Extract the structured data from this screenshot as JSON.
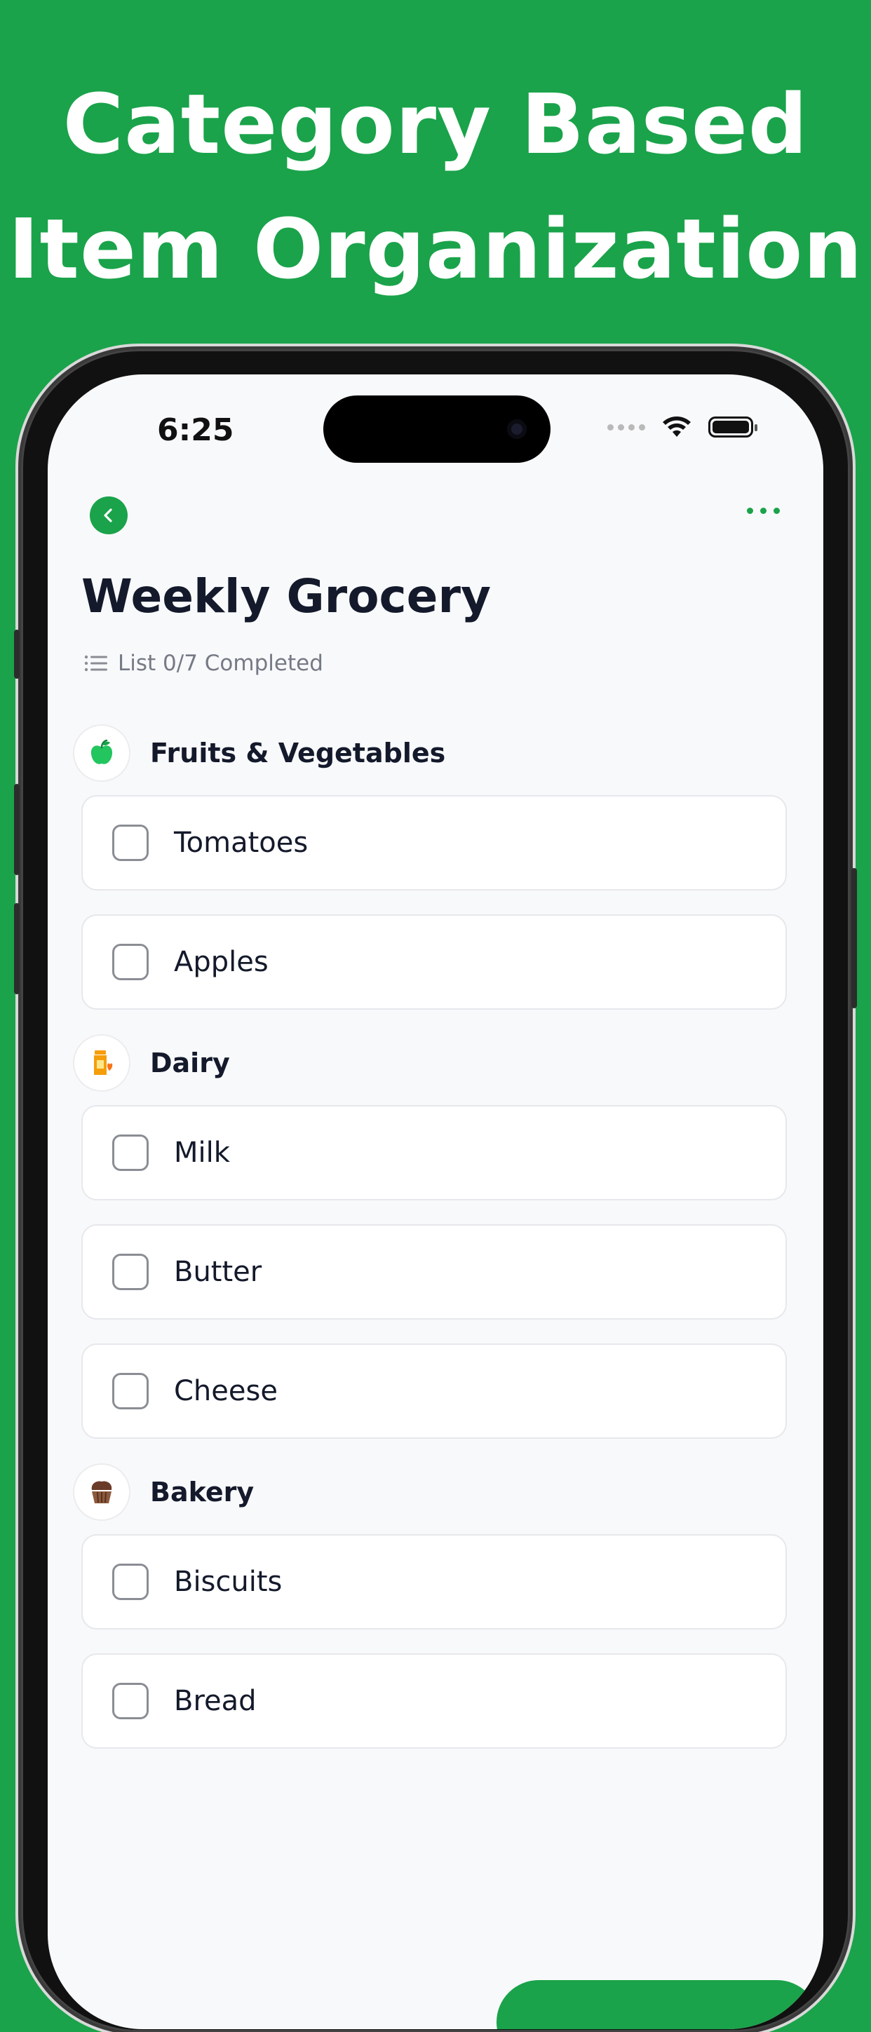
{
  "headline": {
    "line1": "Category Based",
    "line2": "Item Organization"
  },
  "status_bar": {
    "time": "6:25"
  },
  "header": {
    "title": "Weekly Grocery",
    "progress_text": "List 0/7 Completed"
  },
  "categories": [
    {
      "name": "Fruits & Vegetables",
      "icon": "apple-icon",
      "items": [
        {
          "label": "Tomatoes",
          "checked": false
        },
        {
          "label": "Apples",
          "checked": false
        }
      ]
    },
    {
      "name": "Dairy",
      "icon": "milk-carton-icon",
      "items": [
        {
          "label": "Milk",
          "checked": false
        },
        {
          "label": "Butter",
          "checked": false
        },
        {
          "label": "Cheese",
          "checked": false
        }
      ]
    },
    {
      "name": "Bakery",
      "icon": "muffin-icon",
      "items": [
        {
          "label": "Biscuits",
          "checked": false
        },
        {
          "label": "Bread",
          "checked": false
        }
      ]
    }
  ],
  "colors": {
    "brand_green": "#1aa34a",
    "text_dark": "#141a2b",
    "text_muted": "#757a85",
    "apple_green": "#22c55e",
    "dairy_orange": "#f59e0b",
    "bakery_brown": "#6b3b2a"
  }
}
